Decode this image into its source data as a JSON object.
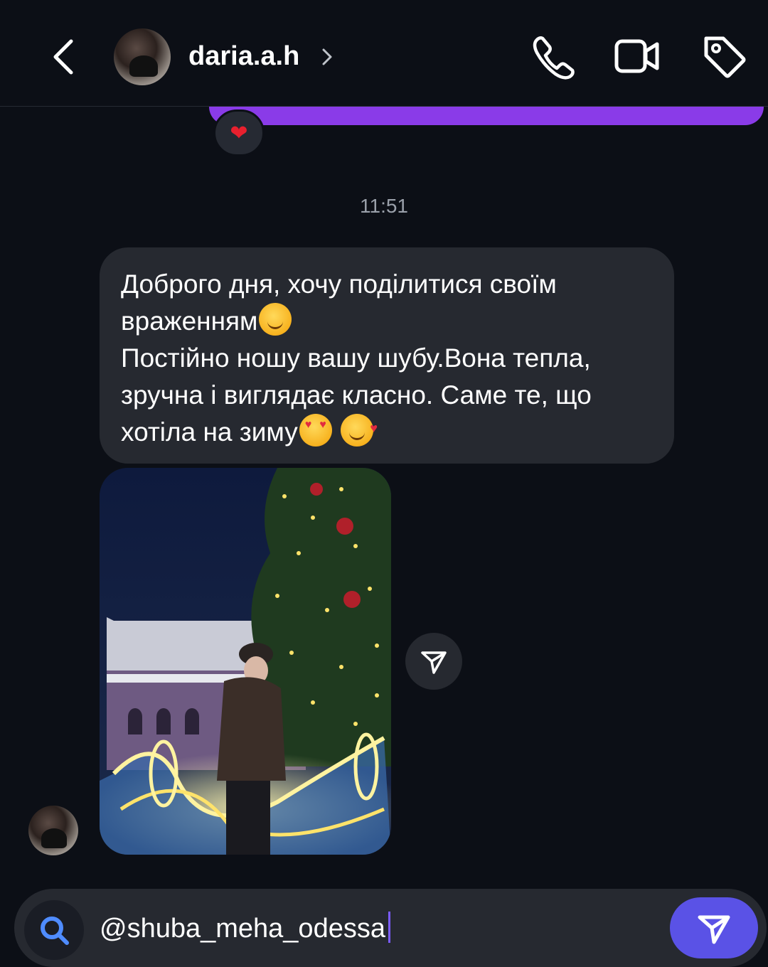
{
  "header": {
    "username": "daria.a.h"
  },
  "thread": {
    "reaction_emoji": "❤",
    "timestamp": "11:51",
    "message_lines": [
      "Доброго дня, хочу поділитися своїм",
      "враженням",
      "Постійно ношу вашу шубу.Вона  тепла,",
      "зручна і виглядає класно. Саме те, що",
      "хотіла на зиму"
    ]
  },
  "composer": {
    "value": "@shuba_meha_odessa"
  },
  "colors": {
    "background": "#0c0f16",
    "bubble": "#262930",
    "sent_bubble": "#8a3be8",
    "send_button": "#5a52e6",
    "search_icon": "#4f8cff"
  },
  "icons": [
    "back-icon",
    "chevron-right-icon",
    "phone-icon",
    "video-icon",
    "tag-icon",
    "share-icon",
    "search-icon",
    "send-icon"
  ]
}
